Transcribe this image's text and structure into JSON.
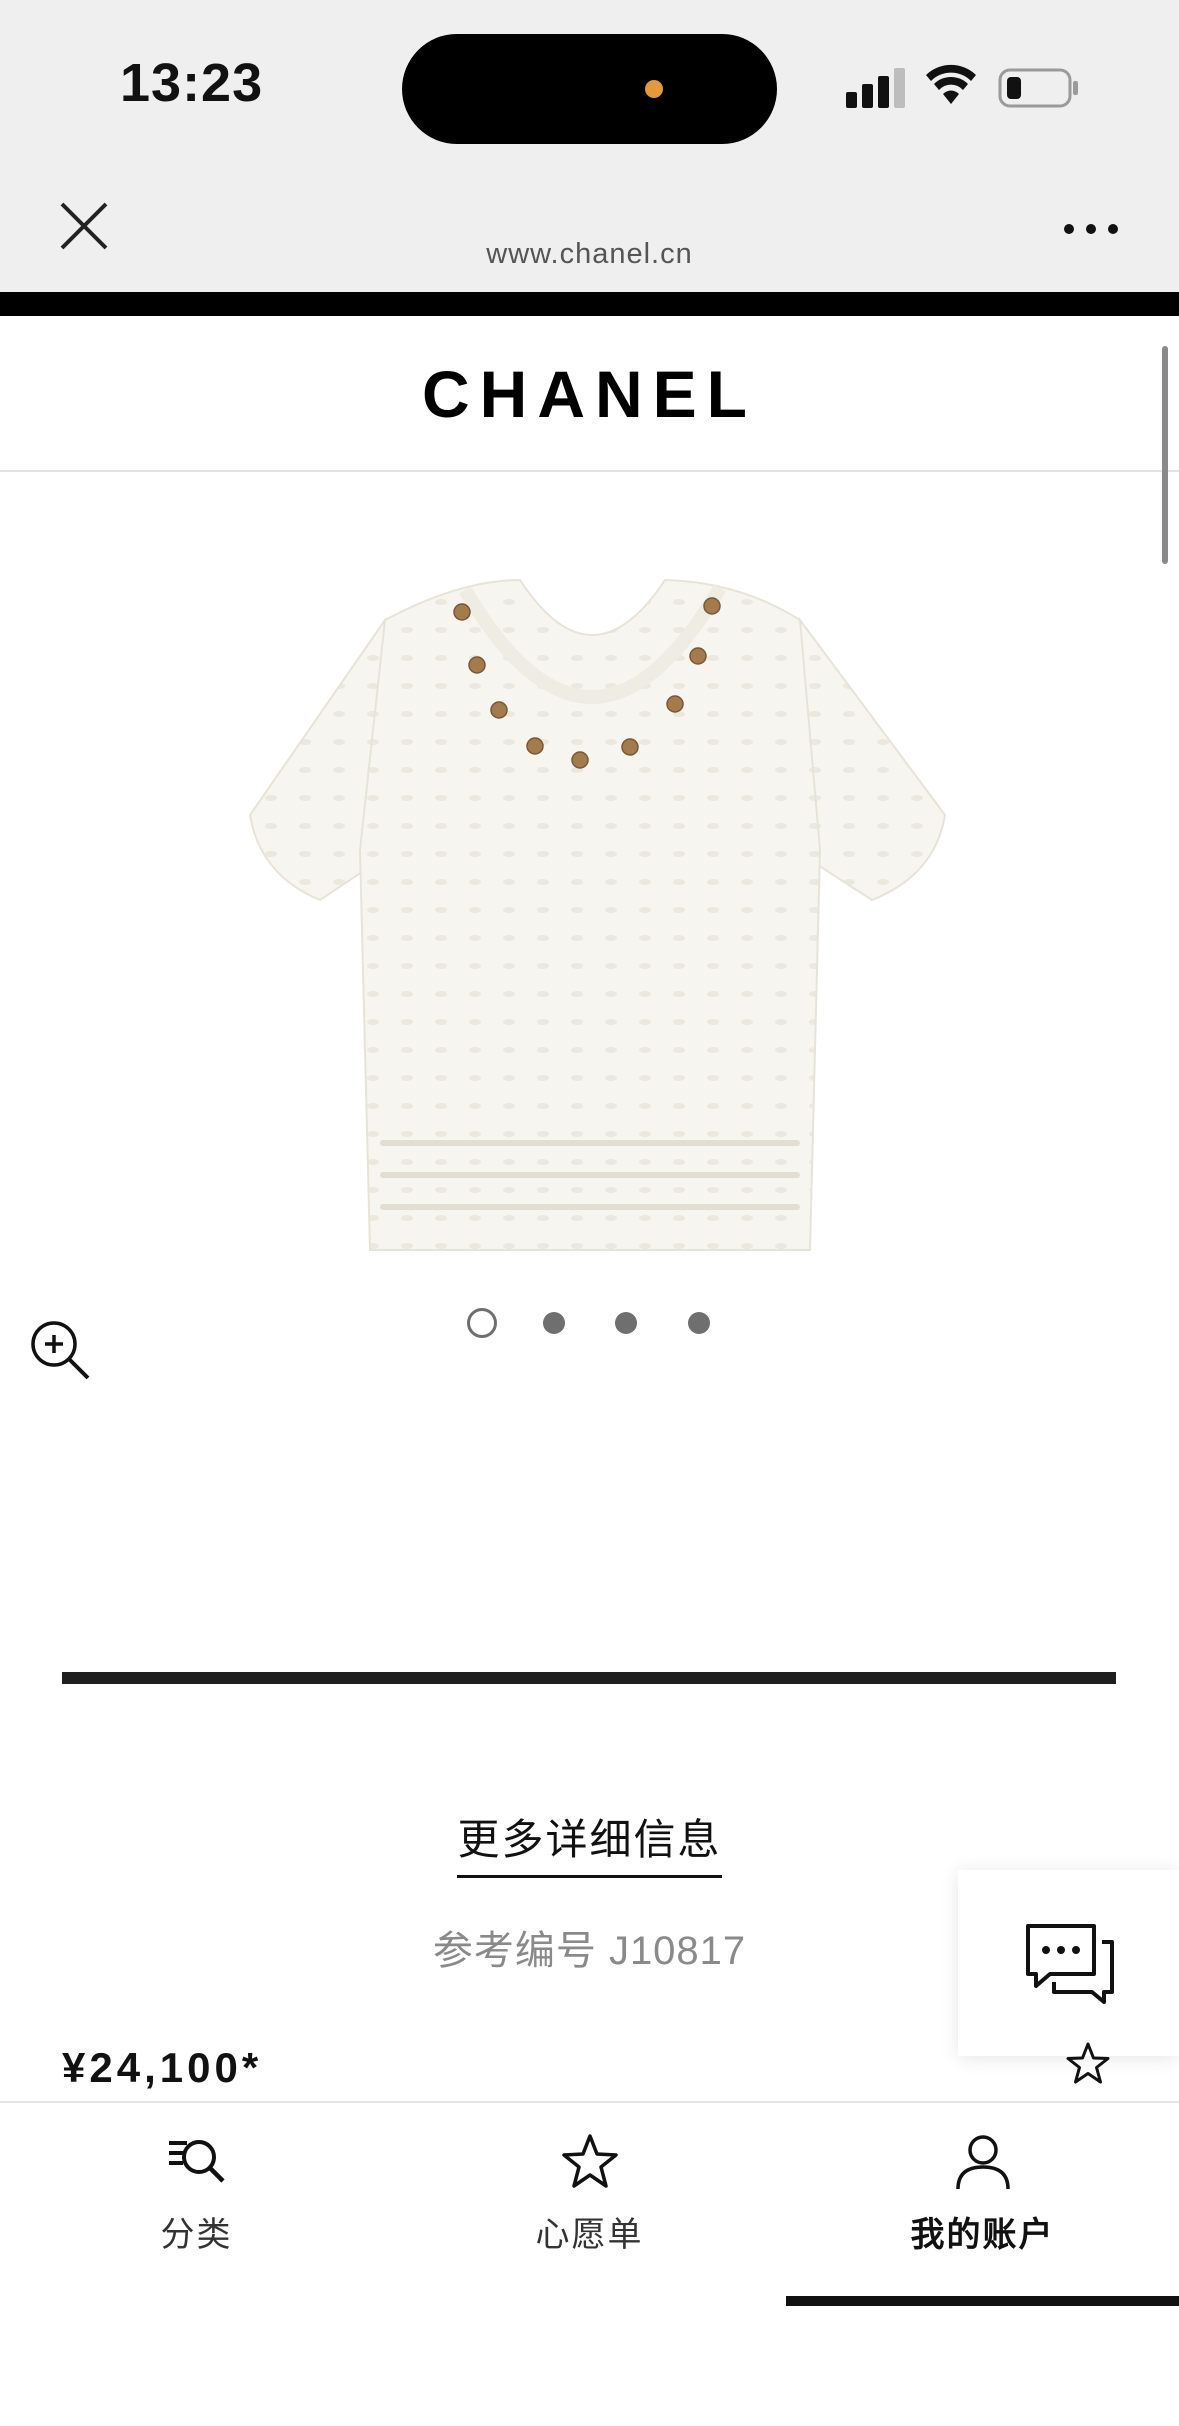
{
  "status_bar": {
    "time": "13:23"
  },
  "browser": {
    "url": "www.chanel.cn"
  },
  "header": {
    "logo": "CHANEL"
  },
  "product": {
    "image_alt": "white knit short-sleeve top",
    "carousel": {
      "count": 4,
      "active_index": 0
    },
    "details_link": "更多详细信息",
    "reference": "参考编号 J10817",
    "price": "¥24,100*"
  },
  "bottom_nav": {
    "items": [
      {
        "label": "分类",
        "icon": "category-search-icon"
      },
      {
        "label": "心愿单",
        "icon": "star-icon"
      },
      {
        "label": "我的账户",
        "icon": "user-icon"
      }
    ],
    "active_index": 2
  },
  "colors": {
    "status_bar_bg": "#efefef",
    "island_dot": "#e39a3b",
    "divider": "#1f1f1f"
  }
}
